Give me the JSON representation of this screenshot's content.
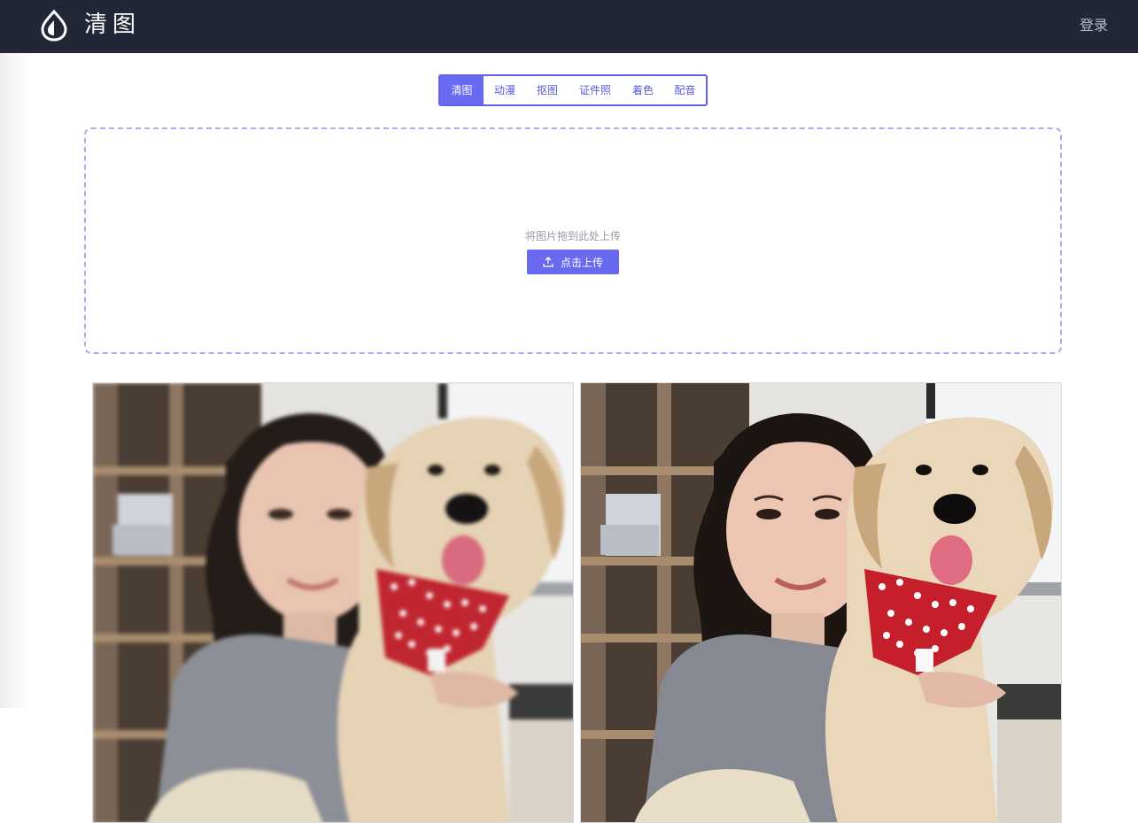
{
  "header": {
    "logo_icon": "drop-logo-icon",
    "brand": "清图",
    "login_label": "登录",
    "background": "#222738"
  },
  "tabs": [
    {
      "label": "清图",
      "active": true
    },
    {
      "label": "动漫",
      "active": false
    },
    {
      "label": "抠图",
      "active": false
    },
    {
      "label": "证件照",
      "active": false
    },
    {
      "label": "着色",
      "active": false
    },
    {
      "label": "配音",
      "active": false
    }
  ],
  "upload": {
    "hint": "将图片拖到此处上传",
    "button_label": "点击上传",
    "button_icon": "upload-icon"
  },
  "comparison": {
    "before": "blurry-photo-girl-with-golden-retriever",
    "after": "sharpened-photo-girl-with-golden-retriever"
  },
  "colors": {
    "accent": "#6a6af0",
    "dashed_border": "#a9aee6"
  }
}
